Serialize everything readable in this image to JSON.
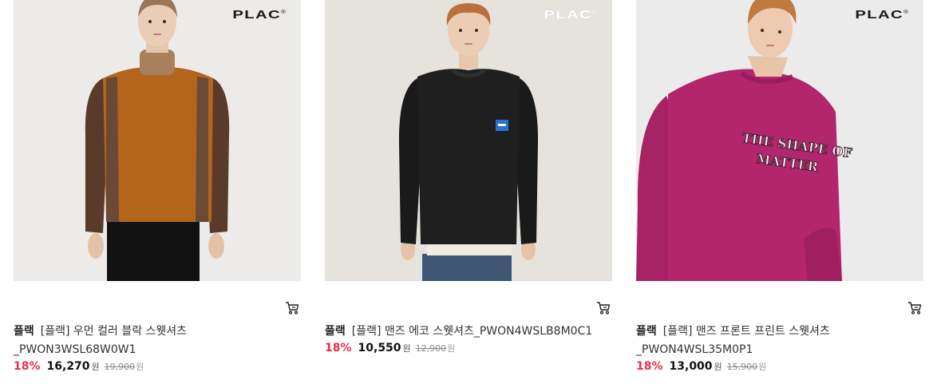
{
  "products": [
    {
      "brand": "플랙",
      "title": "[플랙] 우먼 컬러 블락 스웻셔츠 _PWON3WSL68W0W1",
      "discount": "18%",
      "price": "16,270",
      "price_unit": "원",
      "original_price": "19,900",
      "original_unit": "원",
      "logo": "PLAC",
      "image_background": "#ecebe9",
      "garment_color": "#b3651c"
    },
    {
      "brand": "플랙",
      "title": "[플랙] 맨즈 에코 스웻셔츠_PWON4WSLB8M0C1",
      "discount": "18%",
      "price": "10,550",
      "price_unit": "원",
      "original_price": "12,900",
      "original_unit": "원",
      "logo": "PLAC",
      "image_background": "#e6e2dc",
      "garment_color": "#1c1c1c"
    },
    {
      "brand": "플랙",
      "title": "[플랙] 맨즈 프론트 프린트 스웻셔츠 _PWON4WSL35M0P1",
      "discount": "18%",
      "price": "13,000",
      "price_unit": "원",
      "original_price": "15,900",
      "original_unit": "원",
      "logo": "PLAC",
      "image_background": "#ebebeb",
      "garment_color": "#b3266e"
    }
  ],
  "colors": {
    "discount": "#e8304a",
    "price": "#111111",
    "original_price": "#888888"
  },
  "icons": {
    "cart": "cart-icon"
  }
}
